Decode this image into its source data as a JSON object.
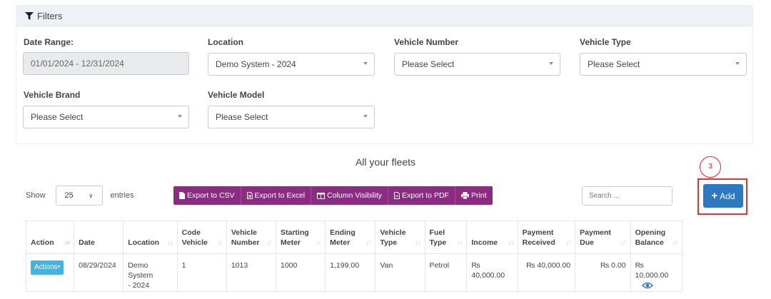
{
  "filters": {
    "title": "Filters",
    "date_range": {
      "label": "Date Range:",
      "value": "01/01/2024 - 12/31/2024"
    },
    "location": {
      "label": "Location",
      "value": "Demo System - 2024"
    },
    "vehicle_number": {
      "label": "Vehicle Number",
      "value": "Please Select"
    },
    "vehicle_type": {
      "label": "Vehicle Type",
      "value": "Please Select"
    },
    "vehicle_brand": {
      "label": "Vehicle Brand",
      "value": "Please Select"
    },
    "vehicle_model": {
      "label": "Vehicle Model",
      "value": "Please Select"
    }
  },
  "page": {
    "title": "All your fleets"
  },
  "annotation": {
    "step": "3",
    "color": "#d63a3a"
  },
  "add_button": {
    "label": "Add"
  },
  "length_menu": {
    "show": "Show",
    "value": "25",
    "entries": "entries"
  },
  "export": {
    "csv": "Export to CSV",
    "excel": "Export to Excel",
    "columns": "Column Visibility",
    "pdf": "Export to PDF",
    "print": "Print"
  },
  "search": {
    "placeholder": "Search ..."
  },
  "table": {
    "headers": [
      [
        "Action"
      ],
      [
        "Date"
      ],
      [
        "Location"
      ],
      [
        "Code",
        "Vehicle"
      ],
      [
        "Vehicle",
        "Number"
      ],
      [
        "Starting",
        "Meter"
      ],
      [
        "Ending",
        "Meter"
      ],
      [
        "Vehicle",
        "Type"
      ],
      [
        "Fuel",
        "Type"
      ],
      [
        "Income"
      ],
      [
        "Payment",
        "Received"
      ],
      [
        "Payment",
        "Due"
      ],
      [
        "Opening",
        "Balance"
      ]
    ],
    "rows": [
      {
        "action": "Actions",
        "date": "08/29/2024",
        "location_l1": "Demo System",
        "location_l2": "- 2024",
        "code_vehicle": "1",
        "vehicle_number": "1013",
        "starting_meter": "1000",
        "ending_meter": "1,199.00",
        "vehicle_type": "Van",
        "fuel_type": "Petrol",
        "income_l1": "₨",
        "income_l2": "40,000.00",
        "payment_received": "₨ 40,000.00",
        "payment_due": "₨ 0.00",
        "opening_balance": "₨ 10,000.00"
      }
    ]
  },
  "colors": {
    "export_purple": "#8b2b82",
    "add_blue": "#2e78c2",
    "actions_cyan": "#45b3e0"
  }
}
